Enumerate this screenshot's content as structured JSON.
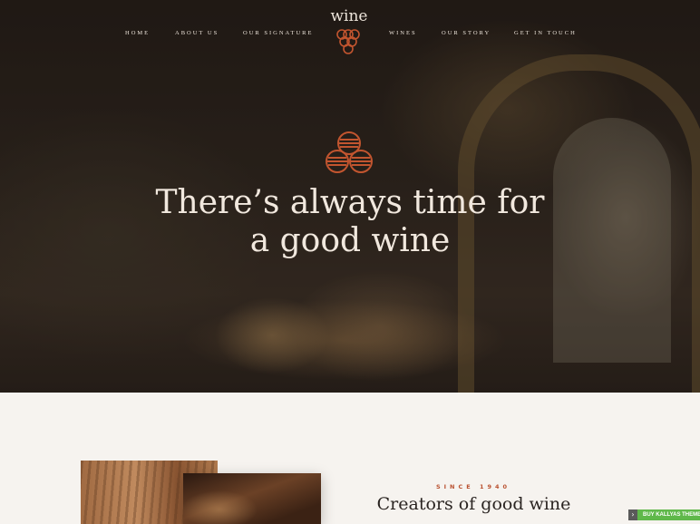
{
  "nav": {
    "items": [
      "HOME",
      "ABOUT US",
      "OUR SIGNATURE",
      "WINES",
      "OUR STORY",
      "GET IN TOUCH"
    ]
  },
  "logo": {
    "text": "wine",
    "icon": "grapes-icon"
  },
  "hero": {
    "icon": "barrels-icon",
    "headline_line1": "There’s always time for",
    "headline_line2": "a good wine"
  },
  "about": {
    "eyebrow": "SINCE 1940",
    "title": "Creators of good wine"
  },
  "badge": {
    "label": "BUY KALLYAS THEME"
  },
  "colors": {
    "accent": "#c2552f",
    "hero_text": "#f1e8de",
    "badge_green": "#5fb84a",
    "background": "#f6f3ef"
  }
}
